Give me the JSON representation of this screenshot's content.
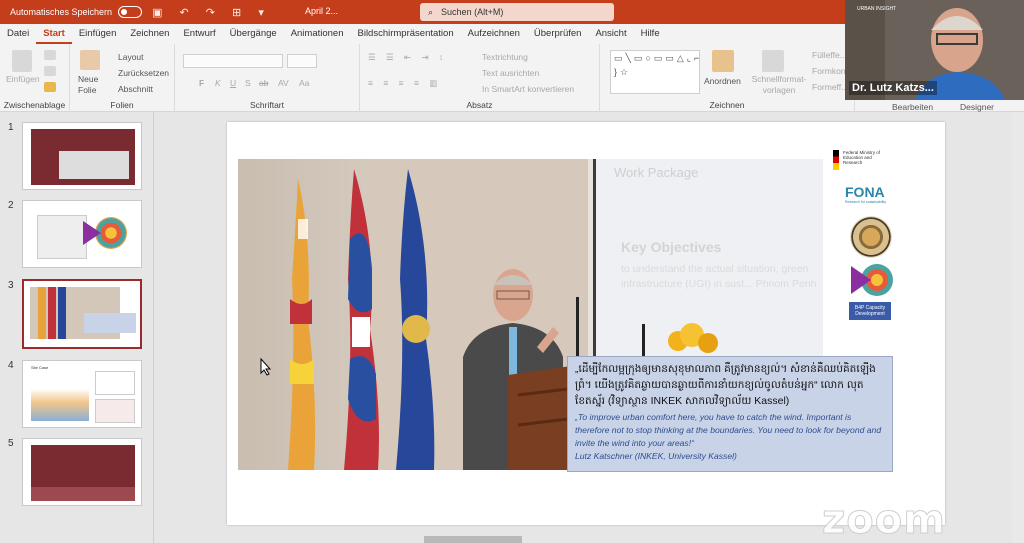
{
  "titlebar": {
    "autosave_label": "Automatisches Speichern",
    "doc_title": "April 2...",
    "search_label": "Suchen (Alt+M)"
  },
  "tabs": [
    "Datei",
    "Start",
    "Einfügen",
    "Zeichnen",
    "Entwurf",
    "Übergänge",
    "Animationen",
    "Bildschirmpräsentation",
    "Aufzeichnen",
    "Überprüfen",
    "Ansicht",
    "Hilfe"
  ],
  "ribbon": {
    "groups": [
      "Zwischenablage",
      "Folien",
      "Schriftart",
      "Absatz",
      "Zeichnen",
      "Bearbeiten",
      "Designer"
    ],
    "clipboard": {
      "paste": "Einfügen"
    },
    "slides": {
      "new_slide": "Neue Folie",
      "layout": "Layout",
      "reset": "Zurücksetzen",
      "section": "Abschnitt"
    },
    "paragraph": {
      "text_direction": "Textrichtung",
      "align_text": "Text ausrichten",
      "smartart": "In SmartArt konvertieren"
    },
    "drawing": {
      "arrange": "Anordnen",
      "quick_styles": "Schnellformat-vorlagen",
      "fill": "Fülleffe...",
      "effect1": "Formkon...",
      "effect2": "Formeff..."
    },
    "font_buttons": [
      "F",
      "K",
      "U",
      "S",
      "ab",
      "AV",
      "Aa"
    ]
  },
  "slide_numbers": [
    "1",
    "2",
    "3",
    "4",
    "5"
  ],
  "slide": {
    "bg_title": "Work Package",
    "bg_key_objectives": "Key Objectives",
    "bg_objective_text": "to understand the actual situation, green infrastructure (UGI) in sust... Phnom Penh",
    "quote_khmer": "„ដើម្បីកែលម្អក្រុងឲ្យមានសុខុមាលភាព គឺត្រូវមានខ្យល់។ សំខាន់គឺឈប់គិតឡើងព្រំ។ យើងត្រូវគិតឆ្ងាយបានឆ្ងាយពីការនាំយកខ្យល់ចូលតំបន់អ្នក“ លោក លុត ខែតស្ន័រ (វិទ្យាស្ថាន INKEK សាកលវិទ្យាល័យ Kassel)",
    "quote_en": "„To improve urban comfort here, you have to catch the wind. Important is therefore not to stop thinking at the boundaries. You need to look for beyond and invite the wind into your areas!“",
    "quote_author": "Lutz Katschner (INKEK, University Kassel)",
    "logo_bmbf": "Federal Ministry of Education and Research",
    "logo_fona": "FONA",
    "logo_fona_sub": "Research for sustainability",
    "logo_b4p": "B4P Capacity Development"
  },
  "thumb_texts": {
    "t4_title": "Site Case"
  },
  "webcam": {
    "name": "Dr. Lutz Katzs...",
    "ui_title": "URBAN INSIGHT"
  },
  "zoom_watermark": "zoom",
  "colors": {
    "accent": "#c43e1c",
    "maroon": "#7a2a31",
    "quote_bg": "#c9d3e8",
    "quote_text": "#2d4d8f"
  }
}
